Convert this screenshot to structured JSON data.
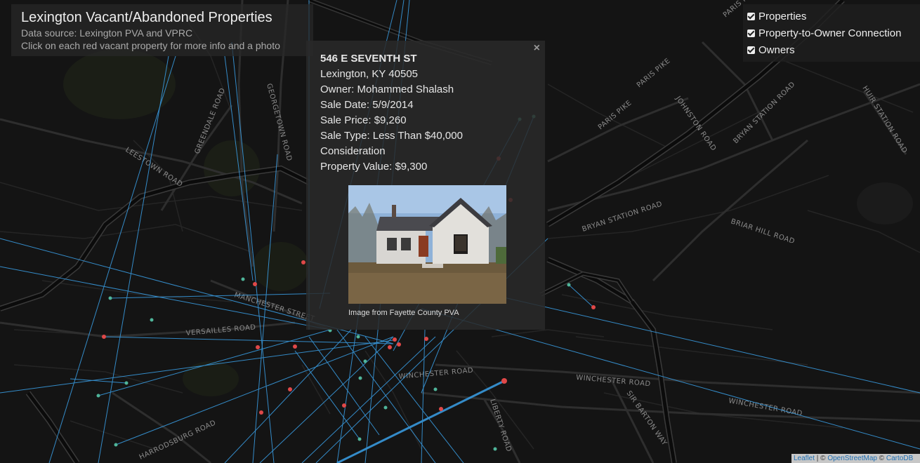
{
  "title_panel": {
    "title": "Lexington Vacant/Abandoned Properties",
    "subtitle_source": "Data source: Lexington PVA and VPRC",
    "subtitle_hint": "Click on each red vacant property for more info and a photo"
  },
  "layers": [
    {
      "label": "Properties",
      "checked": true
    },
    {
      "label": "Property-to-Owner Connection",
      "checked": true
    },
    {
      "label": "Owners",
      "checked": true
    }
  ],
  "popup": {
    "close": "×",
    "address": "546 E SEVENTH ST",
    "city": "Lexington, KY 40505",
    "owner": "Owner: Mohammed Shalash",
    "sale_date": "Sale Date: 5/9/2014",
    "sale_price": "Sale Price: $9,260",
    "sale_type_1": "Sale Type: Less Than $40,000",
    "sale_type_2": "Consideration",
    "property_value": "Property Value: $9,300",
    "caption": "Image from Fayette County PVA"
  },
  "road_labels": [
    "GEORGETOWN ROAD",
    "GREENDALE ROAD",
    "LEESTOWN ROAD",
    "PARIS PIKE",
    "PARIS PIKE",
    "PARIS PIKE",
    "JOHNSTON ROAD",
    "BRYAN STATION ROAD",
    "HUIR STATION ROAD",
    "BRYAN STATION ROAD",
    "BRIAR HILL ROAD",
    "MANCHESTER STREET",
    "VERSAILLES ROAD",
    "WINCHESTER ROAD",
    "WINCHESTER ROAD",
    "WINCHESTER ROAD",
    "LIBERTY ROAD",
    "SIR BARTON WAY",
    "HARRODSBURG ROAD"
  ],
  "attribution": {
    "leaflet": "Leaflet",
    "sep": " | © ",
    "osm": "OpenStreetMap",
    "carto_prefix": " © ",
    "carto": "CartoDB"
  },
  "colors": {
    "background": "#141414",
    "road": "#2a2a2a",
    "highway": "#0a0a0a",
    "connection_line": "#3aa0e8",
    "property_dot": "#e04848",
    "owner_dot": "#4fb59a"
  },
  "icons": [
    "close-icon",
    "checkbox-icon",
    "house-photo"
  ]
}
